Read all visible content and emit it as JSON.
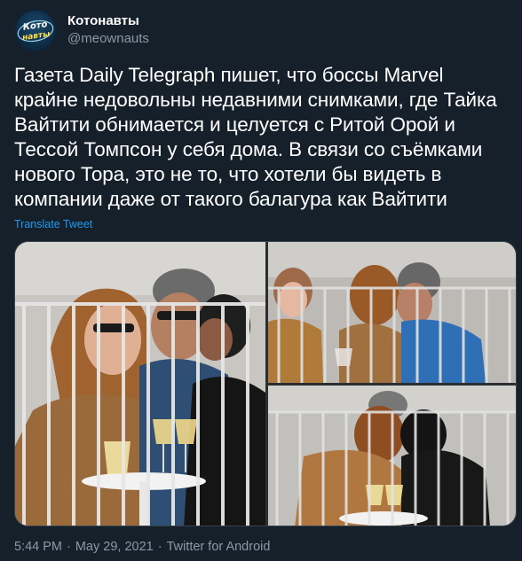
{
  "account": {
    "display_name": "Котонавты",
    "handle": "@meownauts",
    "avatar_text_top": "Кото",
    "avatar_text_bottom": "навты",
    "avatar_bg": "#0d2a42"
  },
  "tweet": {
    "lines": [
      "Газета Daily Telegraph пишет, что боссы Marvel",
      "крайне недовольны недавними снимками, где Тайка",
      "Вайтити обнимается и целуется с Ритой Орой и",
      "Тессой Томпсон у себя дома. В связи со съёмками",
      "нового Тора, это не то, что хотели бы видеть в",
      "компании даже от такого балагура как Вайтити"
    ],
    "translate_label": "Translate Tweet"
  },
  "media": {
    "photos": [
      {
        "name": "photo-main"
      },
      {
        "name": "photo-top-right"
      },
      {
        "name": "photo-bottom-right"
      }
    ]
  },
  "footer": {
    "time": "5:44 PM",
    "sep1": "·",
    "date": "May 29, 2021",
    "sep2": "·",
    "source": "Twitter for Android"
  },
  "colors": {
    "background": "#15202b",
    "text": "#ffffff",
    "muted": "#8b98a5",
    "link": "#1d9bf0"
  }
}
